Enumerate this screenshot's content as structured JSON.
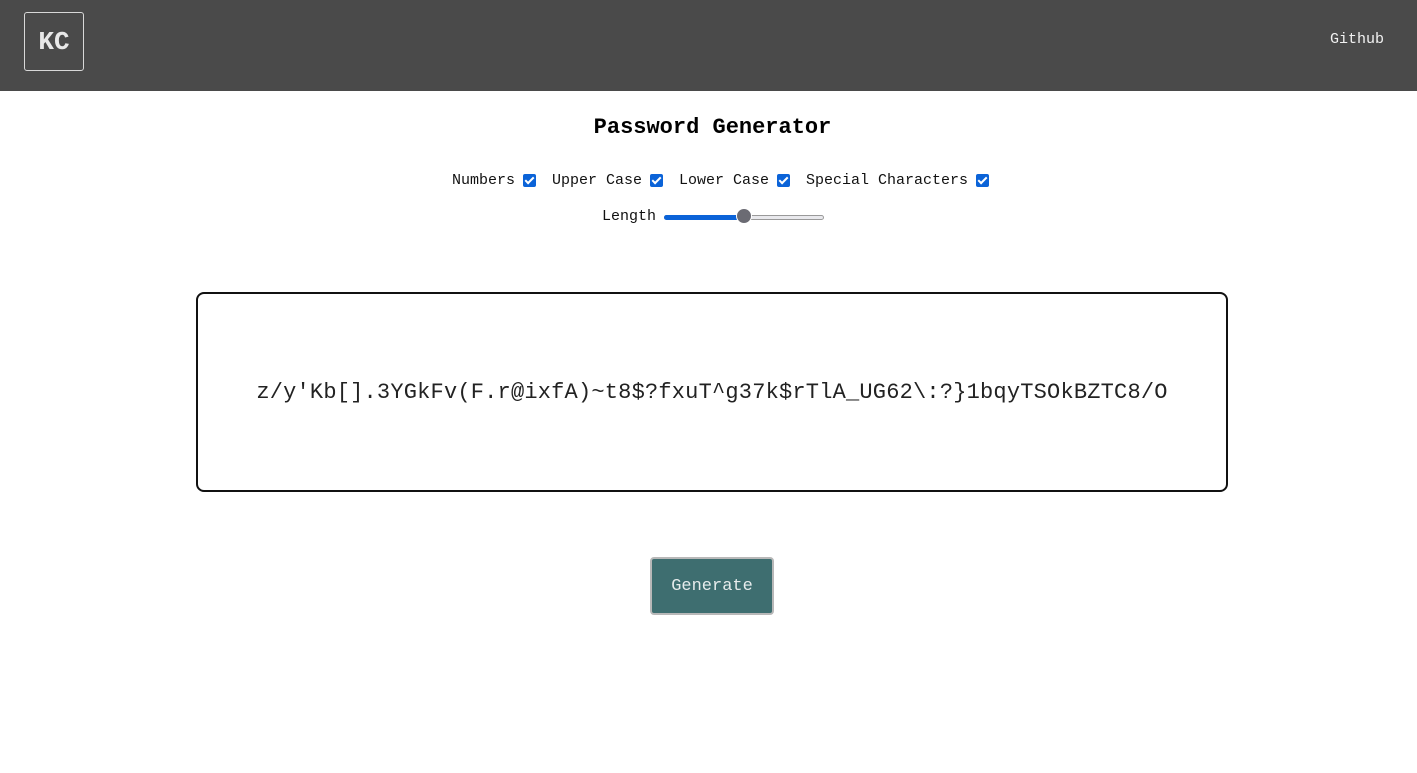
{
  "header": {
    "logo_text": "KC",
    "github_label": "Github",
    "background_color": "#4a4a4a"
  },
  "main": {
    "title": "Password Generator",
    "options": [
      {
        "label": "Numbers",
        "checked": true
      },
      {
        "label": "Upper Case",
        "checked": true
      },
      {
        "label": "Lower Case",
        "checked": true
      },
      {
        "label": "Special Characters",
        "checked": true
      }
    ],
    "length_label": "Length",
    "length_slider_fraction": 0.5,
    "password": "z/y'Kb[].3YGkFv(F.r@ixfA)~t8$?fxuT^g37k$rTlA_UG62\\:?}1bqyTSOkBZTC8/O",
    "generate_label": "Generate",
    "accent_color": "#0b63d8",
    "button_color": "#3e6e70"
  }
}
